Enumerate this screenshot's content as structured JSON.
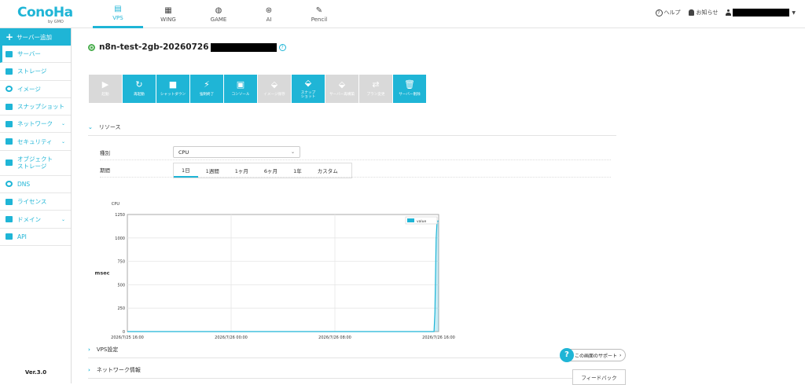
{
  "brand": {
    "logo": "ConoHa",
    "logo_sub": "by GMO"
  },
  "nav": [
    {
      "label": "VPS",
      "icon": "server-icon"
    },
    {
      "label": "WING",
      "icon": "building-icon"
    },
    {
      "label": "GAME",
      "icon": "gamepad-icon"
    },
    {
      "label": "AI",
      "icon": "ai-icon"
    },
    {
      "label": "Pencil",
      "icon": "pencil-doc-icon"
    }
  ],
  "header_links": {
    "help": "ヘルプ",
    "news": "お知らせ"
  },
  "sidebar": {
    "add_label": "サーバー追加",
    "items": [
      {
        "label": "サーバー",
        "icon": "server-icon"
      },
      {
        "label": "ストレージ",
        "icon": "storage-icon"
      },
      {
        "label": "イメージ",
        "icon": "image-icon"
      },
      {
        "label": "スナップショット",
        "icon": "snapshot-icon"
      },
      {
        "label": "ネットワーク",
        "icon": "network-icon"
      },
      {
        "label": "セキュリティ",
        "icon": "key-icon"
      },
      {
        "label": "オブジェクト\nストレージ",
        "icon": "object-storage-icon"
      },
      {
        "label": "DNS",
        "icon": "globe-icon"
      },
      {
        "label": "ライセンス",
        "icon": "license-icon"
      },
      {
        "label": "ドメイン",
        "icon": "domain-icon"
      },
      {
        "label": "API",
        "icon": "api-icon"
      }
    ],
    "version": "Ver.3.0"
  },
  "server": {
    "name": "n8n-test-2gb-20260726",
    "status_color": "#4caf50"
  },
  "actions": [
    {
      "label": "起動",
      "enabled": false,
      "icon": "play-icon"
    },
    {
      "label": "再起動",
      "enabled": true,
      "icon": "restart-icon"
    },
    {
      "label": "シャットダウン",
      "enabled": true,
      "icon": "stop-icon"
    },
    {
      "label": "強制終了",
      "enabled": true,
      "icon": "plug-icon"
    },
    {
      "label": "コンソール",
      "enabled": true,
      "icon": "console-icon"
    },
    {
      "label": "イメージ保存",
      "enabled": false,
      "icon": "image-save-icon"
    },
    {
      "label": "スナップ\nショット",
      "enabled": true,
      "icon": "snapshot-icon"
    },
    {
      "label": "サーバー再構築",
      "enabled": false,
      "icon": "rebuild-icon"
    },
    {
      "label": "プラン変更",
      "enabled": false,
      "icon": "plan-change-icon"
    },
    {
      "label": "サーバー削除",
      "enabled": true,
      "icon": "trash-icon"
    }
  ],
  "resource": {
    "section_title": "リソース",
    "type_label": "種別",
    "type_value": "CPU",
    "period_label": "期間",
    "period_tabs": [
      "1日",
      "1週間",
      "1ヶ月",
      "6ヶ月",
      "1年",
      "カスタム"
    ],
    "active_period": 0
  },
  "chart_data": {
    "type": "line",
    "ylabel_top": "CPU",
    "ylabel": "msec",
    "ylim": [
      0,
      1250
    ],
    "yticks": [
      "0",
      "250",
      "500",
      "750",
      "1000",
      "1250"
    ],
    "xticks": [
      "2026/7/25 16:00",
      "2026/7/26 00:00",
      "2026/7/26 08:00",
      "2026/7/26 16:00"
    ],
    "legend": "value",
    "legend_position": "top-right",
    "grid": true,
    "series": [
      {
        "name": "value",
        "points": [
          [
            0,
            0
          ],
          [
            0.985,
            0
          ],
          [
            0.988,
            200
          ],
          [
            0.992,
            1000
          ],
          [
            0.995,
            1180
          ],
          [
            1.0,
            1180
          ]
        ]
      }
    ],
    "accent": "#1fb5d6"
  },
  "sections": [
    {
      "label": "VPS設定"
    },
    {
      "label": "ネットワーク情報"
    }
  ],
  "support_label": "この画面のサポート",
  "feedback_label": "フィードバック",
  "colors": {
    "accent": "#1fb5d6",
    "disabled": "#d9d9d9"
  }
}
